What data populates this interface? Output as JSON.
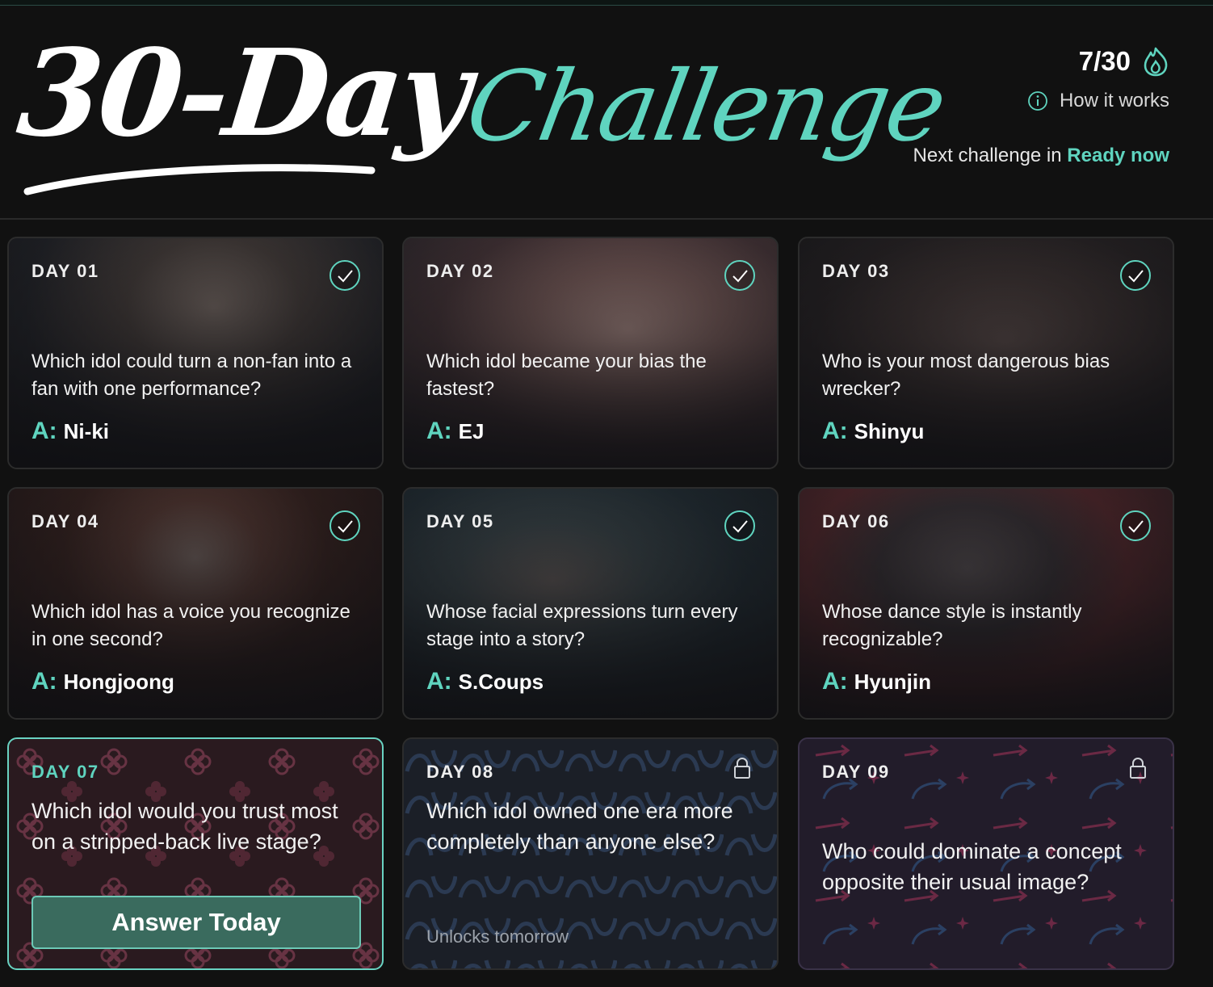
{
  "header": {
    "logo_part1": "30-Day",
    "logo_part2": "Challenge",
    "progress": "7/30",
    "progress_icon": "flame-icon",
    "how_it_works": "How it works",
    "next_label": "Next challenge in",
    "next_value": "Ready now"
  },
  "colors": {
    "accent": "#5fd4bf",
    "background": "#111111",
    "card_border": "#2c2c2c",
    "active_border": "#69d3c2",
    "button_bg": "#3a6b5e"
  },
  "answer_prefix": "A:",
  "cards": [
    {
      "day": "DAY 01",
      "question": "Which idol could turn a non-fan into a fan with one performance?",
      "answer": "Ni-ki",
      "status": "completed"
    },
    {
      "day": "DAY 02",
      "question": "Which idol became your bias the fastest?",
      "answer": "EJ",
      "status": "completed"
    },
    {
      "day": "DAY 03",
      "question": "Who is your most dangerous bias wrecker?",
      "answer": "Shinyu",
      "status": "completed"
    },
    {
      "day": "DAY 04",
      "question": "Which idol has a voice you recognize in one second?",
      "answer": "Hongjoong",
      "status": "completed"
    },
    {
      "day": "DAY 05",
      "question": "Whose facial expressions turn every stage into a story?",
      "answer": "S.Coups",
      "status": "completed"
    },
    {
      "day": "DAY 06",
      "question": "Whose dance style is instantly recognizable?",
      "answer": "Hyunjin",
      "status": "completed"
    },
    {
      "day": "DAY 07",
      "question": "Which idol would you trust most on a stripped-back live stage?",
      "button": "Answer Today",
      "status": "today"
    },
    {
      "day": "DAY 08",
      "question": "Which idol owned one era more completely than anyone else?",
      "note": "Unlocks tomorrow",
      "status": "locked"
    },
    {
      "day": "DAY 09",
      "question": "Who could dominate a concept opposite their usual image?",
      "status": "locked"
    }
  ]
}
